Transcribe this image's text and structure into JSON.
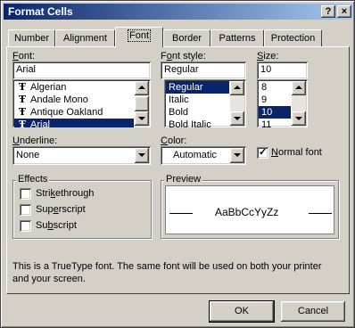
{
  "window": {
    "title": "Format Cells",
    "help_label": "?",
    "close_label": "×"
  },
  "tabs": [
    {
      "label": "Number",
      "active": false
    },
    {
      "label": "Alignment",
      "active": false
    },
    {
      "label": "Font",
      "active": true
    },
    {
      "label": "Border",
      "active": false
    },
    {
      "label": "Patterns",
      "active": false
    },
    {
      "label": "Protection",
      "active": false
    }
  ],
  "font": {
    "label_pre": "",
    "label_u": "F",
    "label_post": "ont:",
    "value": "Arial",
    "items": [
      "Algerian",
      "Andale Mono",
      "Antique Oakland",
      "Arial"
    ],
    "selected_index": 3,
    "item_icon": "truetype-icon"
  },
  "font_style": {
    "label_pre": "F",
    "label_u": "o",
    "label_post": "nt style:",
    "value": "Regular",
    "items": [
      "Regular",
      "Italic",
      "Bold",
      "Bold Italic"
    ],
    "selected_index": 0
  },
  "size": {
    "label_pre": "",
    "label_u": "S",
    "label_post": "ize:",
    "value": "10",
    "items": [
      "8",
      "9",
      "10",
      "11"
    ],
    "selected_index": 2
  },
  "underline": {
    "label_pre": "",
    "label_u": "U",
    "label_post": "nderline:",
    "value": "None"
  },
  "color": {
    "label_pre": "",
    "label_u": "C",
    "label_post": "olor:",
    "value": "Automatic"
  },
  "normal_font": {
    "label_pre": "",
    "label_u": "N",
    "label_post": "ormal font",
    "checked": true
  },
  "effects": {
    "title": "Effects",
    "items": [
      {
        "pre": "Stri",
        "u": "k",
        "post": "ethrough",
        "checked": false
      },
      {
        "pre": "Sup",
        "u": "e",
        "post": "rscript",
        "checked": false
      },
      {
        "pre": "Su",
        "u": "b",
        "post": "script",
        "checked": false
      }
    ]
  },
  "preview": {
    "title": "Preview",
    "sample": "AaBbCcYyZz"
  },
  "info_text": "This is a TrueType font.  The same font will be used on both your printer and your screen.",
  "buttons": {
    "ok": "OK",
    "cancel": "Cancel"
  }
}
